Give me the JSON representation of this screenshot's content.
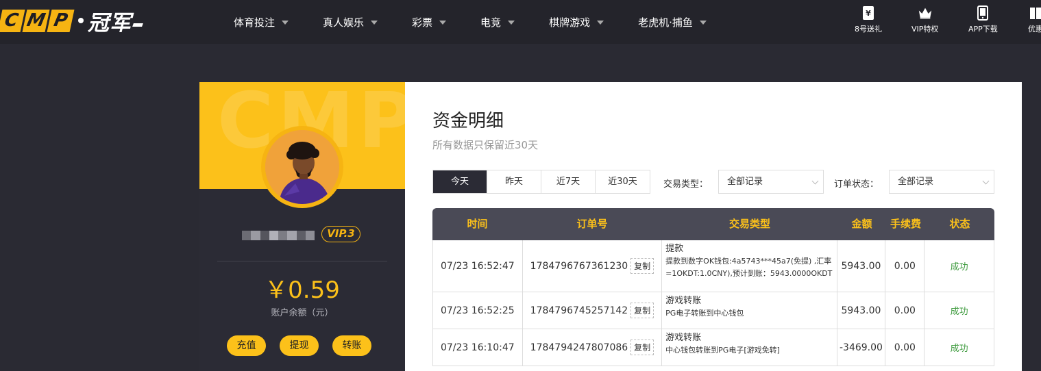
{
  "logo": {
    "letters": [
      "C",
      "M",
      "P"
    ],
    "cn": "冠军"
  },
  "nav": [
    {
      "label": "体育投注"
    },
    {
      "label": "真人娱乐"
    },
    {
      "label": "彩票"
    },
    {
      "label": "电竞"
    },
    {
      "label": "棋牌游戏"
    },
    {
      "label": "老虎机·捕鱼"
    }
  ],
  "quick": [
    {
      "label": "8号送礼",
      "icon": "ticket-icon"
    },
    {
      "label": "VIP特权",
      "icon": "crown-icon"
    },
    {
      "label": "APP下载",
      "icon": "tablet-icon"
    },
    {
      "label": "优惠",
      "icon": "gift-icon"
    }
  ],
  "profile": {
    "watermark": "CMP",
    "vip": "VIP.3",
    "balance": "￥0.59",
    "balance_label": "账户余额（元）",
    "buttons": {
      "deposit": "充值",
      "withdraw": "提现",
      "transfer": "转账"
    }
  },
  "main": {
    "title": "资金明细",
    "subtitle": "所有数据只保留近30天",
    "tabs": [
      "今天",
      "昨天",
      "近7天",
      "近30天"
    ],
    "filters": {
      "type_label": "交易类型：",
      "type_value": "全部记录",
      "status_label": "订单状态：",
      "status_value": "全部记录"
    }
  },
  "table": {
    "headers": [
      "时间",
      "订单号",
      "交易类型",
      "金额",
      "手续费",
      "状态"
    ],
    "copy_label": "复制",
    "rows": [
      {
        "time": "07/23 16:52:47",
        "order": "1784796767361230",
        "type_title": "提款",
        "type_desc": "提款到数字OK钱包:4a5743***45a7(免提) ,汇率=1OKDT:1.0CNY),预计到账：5943.0000OKDT",
        "amount": "5943.00",
        "fee": "0.00",
        "status": "成功"
      },
      {
        "time": "07/23 16:52:25",
        "order": "1784796745257142",
        "type_title": "游戏转账",
        "type_desc": "PG电子转账到中心钱包",
        "amount": "5943.00",
        "fee": "0.00",
        "status": "成功"
      },
      {
        "time": "07/23 16:10:47",
        "order": "1784794247807086",
        "type_title": "游戏转账",
        "type_desc": "中心钱包转账到PG电子[游戏免转]",
        "amount": "-3469.00",
        "fee": "0.00",
        "status": "成功"
      }
    ]
  },
  "colors": {
    "accent": "#fcc11a",
    "dark": "#2b2b35",
    "success": "#3d9a3d"
  }
}
